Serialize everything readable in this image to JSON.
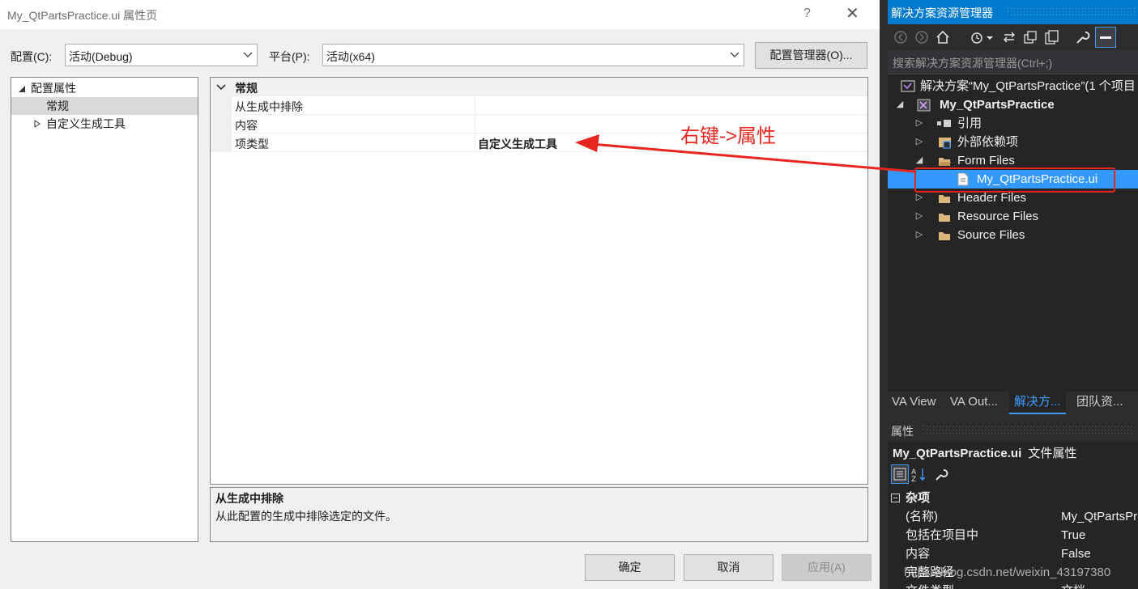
{
  "dialog": {
    "title": "My_QtPartsPractice.ui 属性页",
    "help": "?",
    "close": "✕",
    "config_label": "配置(C):",
    "config_value": "活动(Debug)",
    "platform_label": "平台(P):",
    "platform_value": "活动(x64)",
    "config_manager": "配置管理器(O)...",
    "tree": {
      "root": "配置属性",
      "items": [
        "常规",
        "自定义生成工具"
      ]
    },
    "grid": {
      "category": "常规",
      "rows": [
        {
          "name": "从生成中排除",
          "value": ""
        },
        {
          "name": "内容",
          "value": ""
        },
        {
          "name": "项类型",
          "value": "自定义生成工具"
        }
      ]
    },
    "description": {
      "title": "从生成中排除",
      "text": "从此配置的生成中排除选定的文件。"
    },
    "buttons": {
      "ok": "确定",
      "cancel": "取消",
      "apply": "应用(A)"
    }
  },
  "annotation": {
    "text": "右键->属性",
    "color": "#e8251f"
  },
  "explorer": {
    "title": "解决方案资源管理器",
    "search_placeholder": "搜索解决方案资源管理器(Ctrl+;)",
    "solution": "解决方案“My_QtPartsPractice”(1 个项目",
    "project": "My_QtPartsPractice",
    "nodes": [
      "引用",
      "外部依赖项",
      "Form Files",
      "My_QtPartsPractice.ui",
      "Header Files",
      "Resource Files",
      "Source Files"
    ],
    "tabs": [
      "VA View",
      "VA Out...",
      "解决方...",
      "团队资..."
    ],
    "accent": "#007acc"
  },
  "properties": {
    "header": "属性",
    "object_name": "My_QtPartsPractice.ui",
    "object_type": "文件属性",
    "category": "杂项",
    "rows": [
      {
        "key": "(名称)",
        "value": "My_QtPartsPr"
      },
      {
        "key": "包括在项目中",
        "value": "True"
      },
      {
        "key": "内容",
        "value": "False"
      },
      {
        "key": "完整路径",
        "value": ""
      },
      {
        "key": "文件类型",
        "value": "文档"
      }
    ]
  },
  "watermark": "https://blog.csdn.net/weixin_43197380"
}
